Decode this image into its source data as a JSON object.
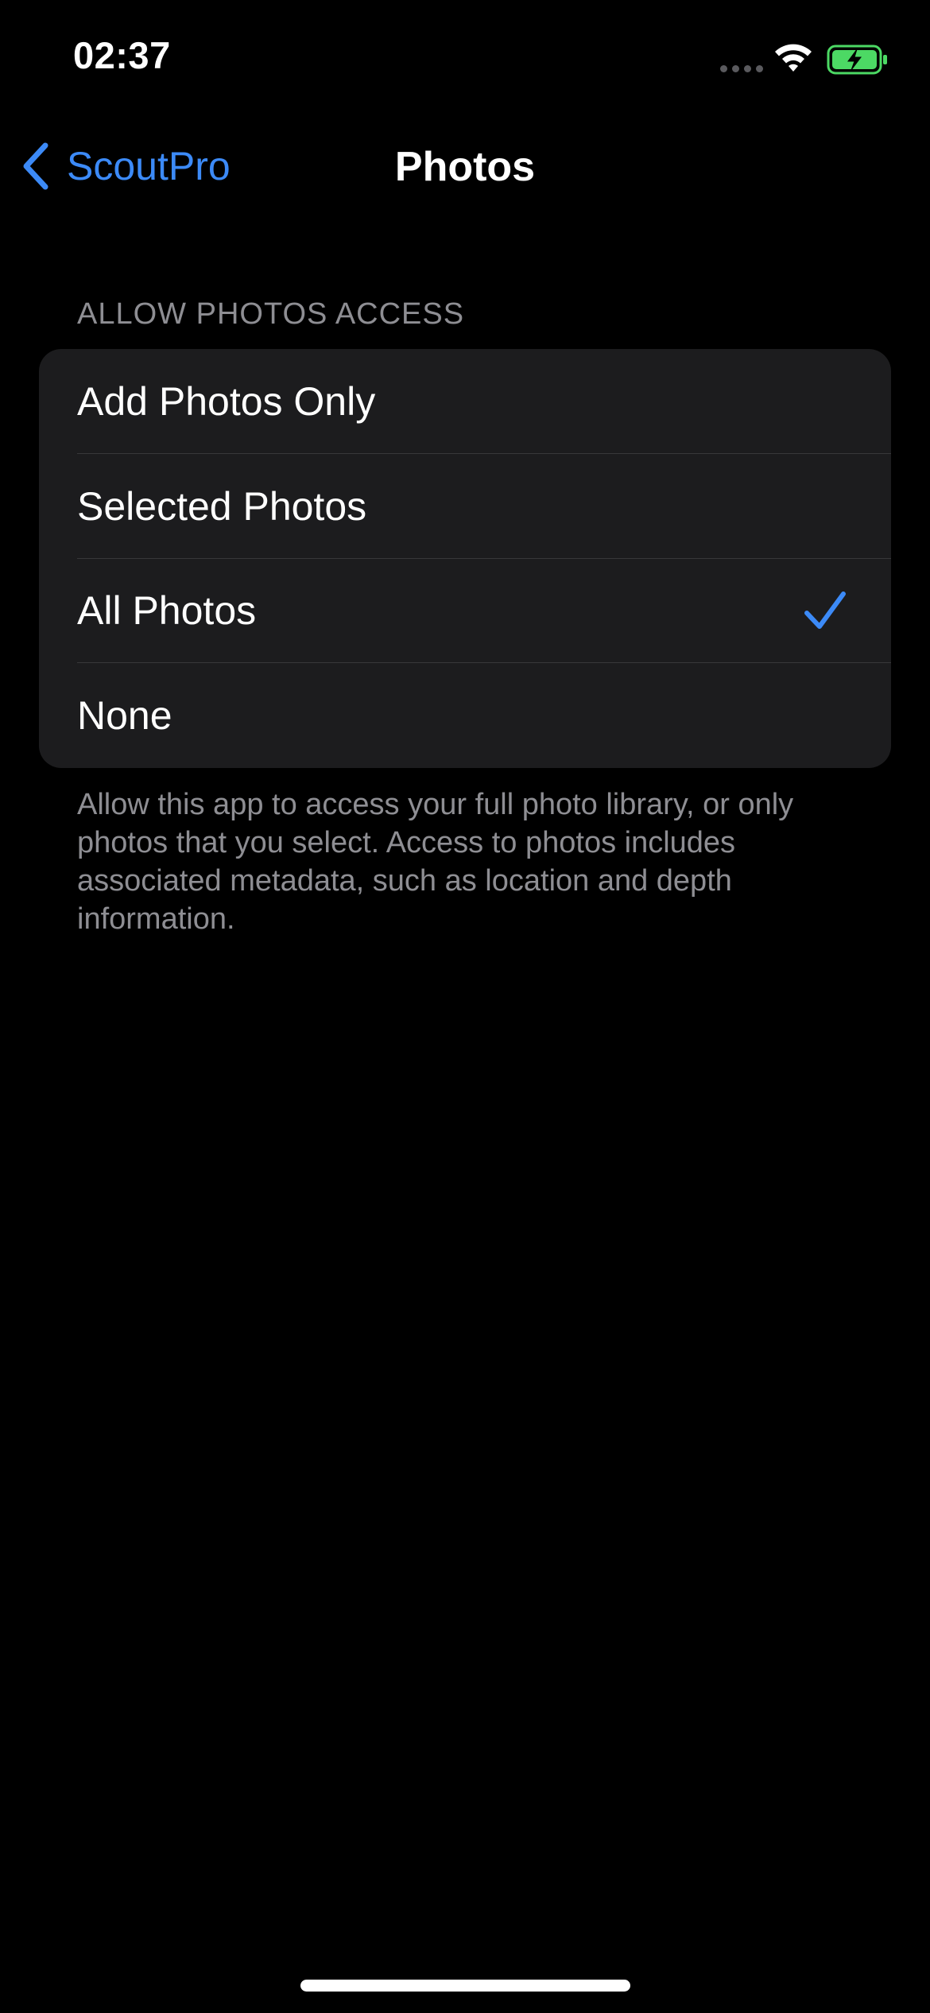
{
  "status_bar": {
    "time": "02:37",
    "icons": [
      "signal-dots-icon",
      "wifi-icon",
      "battery-charging-icon"
    ],
    "battery_color": "#4cd964"
  },
  "nav": {
    "back_label": "ScoutPro",
    "title": "Photos"
  },
  "section": {
    "header": "ALLOW PHOTOS ACCESS",
    "options": [
      {
        "label": "Add Photos Only",
        "selected": false
      },
      {
        "label": "Selected Photos",
        "selected": false
      },
      {
        "label": "All Photos",
        "selected": true
      },
      {
        "label": "None",
        "selected": false
      }
    ],
    "footer": "Allow this app to access your full photo library, or only photos that you select. Access to photos includes associated metadata, such as location and depth information."
  },
  "colors": {
    "accent": "#3c8af7",
    "background": "#000000",
    "group_background": "#1c1c1e",
    "secondary_text": "#8e8e93"
  }
}
